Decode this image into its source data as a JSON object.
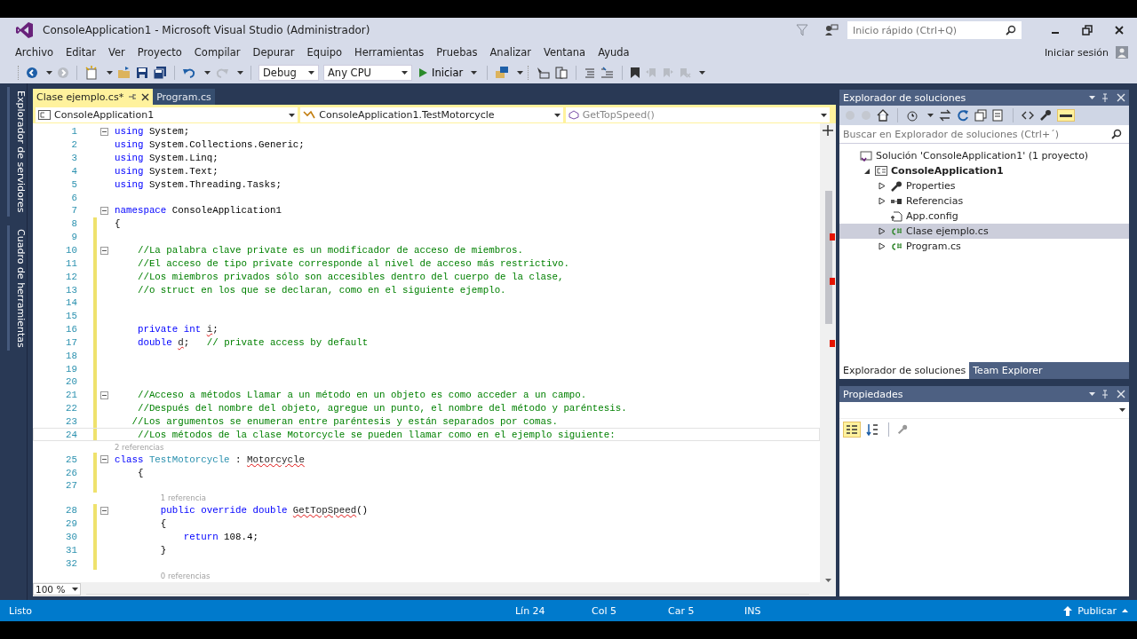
{
  "window": {
    "title": "ConsoleApplication1 - Microsoft Visual Studio (Administrador)",
    "quick_launch": {
      "placeholder": "Inicio rápido (Ctrl+Q)"
    },
    "sign_in": "Iniciar sesión"
  },
  "menu": [
    "Archivo",
    "Editar",
    "Ver",
    "Proyecto",
    "Compilar",
    "Depurar",
    "Equipo",
    "Herramientas",
    "Pruebas",
    "Analizar",
    "Ventana",
    "Ayuda"
  ],
  "toolbar": {
    "configuration": "Debug",
    "platform": "Any CPU",
    "start": "Iniciar"
  },
  "side_tabs": [
    "Explorador de servidores",
    "Cuadro de herramientas"
  ],
  "editor": {
    "tabs": [
      {
        "label": "Clase ejemplo.cs*",
        "selected": true
      },
      {
        "label": "Program.cs",
        "selected": false
      }
    ],
    "nav": [
      "ConsoleApplication1",
      "ConsoleApplication1.TestMotorcycle",
      "GetTopSpeed()"
    ],
    "zoom": "100 %",
    "lines": [
      {
        "kind": "code",
        "n": "1",
        "fold": true,
        "changed": false,
        "current": false,
        "tokens": [
          {
            "kind": "kw",
            "text": "using "
          },
          {
            "kind": "plain",
            "text": "System;"
          }
        ]
      },
      {
        "kind": "code",
        "n": "2",
        "fold": false,
        "changed": false,
        "current": false,
        "tokens": [
          {
            "kind": "kw",
            "text": "using "
          },
          {
            "kind": "plain",
            "text": "System.Collections.Generic;"
          }
        ]
      },
      {
        "kind": "code",
        "n": "3",
        "fold": false,
        "changed": false,
        "current": false,
        "tokens": [
          {
            "kind": "kw",
            "text": "using "
          },
          {
            "kind": "plain",
            "text": "System.Linq;"
          }
        ]
      },
      {
        "kind": "code",
        "n": "4",
        "fold": false,
        "changed": false,
        "current": false,
        "tokens": [
          {
            "kind": "kw",
            "text": "using "
          },
          {
            "kind": "plain",
            "text": "System.Text;"
          }
        ]
      },
      {
        "kind": "code",
        "n": "5",
        "fold": false,
        "changed": false,
        "current": false,
        "tokens": [
          {
            "kind": "kw",
            "text": "using "
          },
          {
            "kind": "plain",
            "text": "System.Threading.Tasks;"
          }
        ]
      },
      {
        "kind": "code",
        "n": "6",
        "fold": false,
        "changed": false,
        "current": false
      },
      {
        "kind": "code",
        "n": "7",
        "fold": true,
        "changed": false,
        "current": false,
        "tokens": [
          {
            "kind": "kw",
            "text": "namespace "
          },
          {
            "kind": "plain",
            "text": "ConsoleApplication1"
          }
        ]
      },
      {
        "kind": "code",
        "n": "8",
        "fold": false,
        "changed": true,
        "current": false,
        "tokens": [
          {
            "kind": "plain",
            "text": "{"
          }
        ]
      },
      {
        "kind": "code",
        "n": "9",
        "fold": false,
        "changed": true,
        "current": false
      },
      {
        "kind": "code",
        "n": "10",
        "fold": true,
        "changed": true,
        "current": false,
        "tokens": [
          {
            "kind": "com",
            "text": "    //La palabra clave private es un modificador de acceso de miembros."
          }
        ]
      },
      {
        "kind": "code",
        "n": "11",
        "fold": false,
        "changed": true,
        "current": false,
        "tokens": [
          {
            "kind": "com",
            "text": "    //El acceso de tipo private corresponde al nivel de acceso más restrictivo."
          }
        ]
      },
      {
        "kind": "code",
        "n": "12",
        "fold": false,
        "changed": true,
        "current": false,
        "tokens": [
          {
            "kind": "com",
            "text": "    //Los miembros privados sólo son accesibles dentro del cuerpo de la clase,"
          }
        ]
      },
      {
        "kind": "code",
        "n": "13",
        "fold": false,
        "changed": true,
        "current": false,
        "tokens": [
          {
            "kind": "com",
            "text": "    //o struct en los que se declaran, como en el siguiente ejemplo."
          }
        ]
      },
      {
        "kind": "code",
        "n": "14",
        "fold": false,
        "changed": true,
        "current": false
      },
      {
        "kind": "code",
        "n": "15",
        "fold": false,
        "changed": true,
        "current": false
      },
      {
        "kind": "code",
        "n": "16",
        "fold": false,
        "changed": true,
        "current": false,
        "tokens": [
          {
            "kind": "kw",
            "text": "    private int "
          },
          {
            "kind": "err",
            "text": "i"
          },
          {
            "kind": "plain",
            "text": ";"
          }
        ]
      },
      {
        "kind": "code",
        "n": "17",
        "fold": false,
        "changed": true,
        "current": false,
        "tokens": [
          {
            "kind": "kw",
            "text": "    double "
          },
          {
            "kind": "err",
            "text": "d"
          },
          {
            "kind": "plain",
            "text": ";"
          },
          {
            "kind": "com",
            "text": "   // private access by default"
          }
        ]
      },
      {
        "kind": "code",
        "n": "18",
        "fold": false,
        "changed": true,
        "current": false
      },
      {
        "kind": "code",
        "n": "19",
        "fold": false,
        "changed": true,
        "current": false
      },
      {
        "kind": "code",
        "n": "20",
        "fold": false,
        "changed": true,
        "current": false
      },
      {
        "kind": "code",
        "n": "21",
        "fold": true,
        "changed": true,
        "current": false,
        "tokens": [
          {
            "kind": "com",
            "text": "    //Acceso a métodos Llamar a un método en un objeto es como acceder a un campo."
          }
        ]
      },
      {
        "kind": "code",
        "n": "22",
        "fold": false,
        "changed": true,
        "current": false,
        "tokens": [
          {
            "kind": "com",
            "text": "    //Después del nombre del objeto, agregue un punto, el nombre del método y paréntesis."
          }
        ]
      },
      {
        "kind": "code",
        "n": "23",
        "fold": false,
        "changed": true,
        "current": false,
        "tokens": [
          {
            "kind": "com",
            "text": "   //Los argumentos se enumeran entre paréntesis y están separados por comas."
          }
        ]
      },
      {
        "kind": "code",
        "n": "24",
        "fold": false,
        "changed": true,
        "current": true,
        "tokens": [
          {
            "kind": "com",
            "text": "    //Los métodos de la clase Motorcycle se pueden llamar como en el ejemplo siguiente:"
          }
        ]
      },
      {
        "kind": "lens",
        "text": "2 referencias"
      },
      {
        "kind": "code",
        "n": "25",
        "fold": true,
        "changed": true,
        "current": false,
        "tokens": [
          {
            "kind": "kw",
            "text": "class "
          },
          {
            "kind": "type",
            "text": "TestMotorcycle"
          },
          {
            "kind": "plain",
            "text": " : "
          },
          {
            "kind": "err",
            "text": "Motorcycle"
          }
        ]
      },
      {
        "kind": "code",
        "n": "26",
        "fold": false,
        "changed": true,
        "current": false,
        "tokens": [
          {
            "kind": "plain",
            "text": "    {"
          }
        ]
      },
      {
        "kind": "code",
        "n": "27",
        "fold": false,
        "changed": true,
        "current": false
      },
      {
        "kind": "lens",
        "text": "1 referencia"
      },
      {
        "kind": "code",
        "n": "28",
        "fold": true,
        "changed": true,
        "current": false,
        "tokens": [
          {
            "kind": "kw",
            "text": "        public override double "
          },
          {
            "kind": "err",
            "text": "GetTopSpeed"
          },
          {
            "kind": "plain",
            "text": "()"
          }
        ]
      },
      {
        "kind": "code",
        "n": "29",
        "fold": false,
        "changed": true,
        "current": false,
        "tokens": [
          {
            "kind": "plain",
            "text": "        {"
          }
        ]
      },
      {
        "kind": "code",
        "n": "30",
        "fold": false,
        "changed": true,
        "current": false,
        "tokens": [
          {
            "kind": "kw",
            "text": "            return "
          },
          {
            "kind": "plain",
            "text": "108.4;"
          }
        ]
      },
      {
        "kind": "code",
        "n": "31",
        "fold": false,
        "changed": true,
        "current": false,
        "tokens": [
          {
            "kind": "plain",
            "text": "        }"
          }
        ]
      },
      {
        "kind": "code",
        "n": "32",
        "fold": false,
        "changed": true,
        "current": false
      },
      {
        "kind": "lens",
        "text": "0 referencias"
      }
    ]
  },
  "solution_explorer": {
    "title": "Explorador de soluciones",
    "search": {
      "placeholder": "Buscar en Explorador de soluciones (Ctrl+´)"
    },
    "tree": [
      {
        "kind": "solution",
        "label": "Solución 'ConsoleApplication1'  (1 proyecto)",
        "selected": false,
        "children": [
          {
            "kind": "project",
            "label": "ConsoleApplication1",
            "expanded": true,
            "selected": false,
            "children": [
              {
                "kind": "wrench",
                "label": "Properties",
                "expanded": false,
                "selected": false
              },
              {
                "kind": "references",
                "label": "Referencias",
                "expanded": false,
                "selected": false
              },
              {
                "kind": "config",
                "label": "App.config",
                "selected": false
              },
              {
                "kind": "csharp",
                "label": "Clase ejemplo.cs",
                "expanded": false,
                "selected": true
              },
              {
                "kind": "csharp",
                "label": "Program.cs",
                "expanded": false,
                "selected": false
              }
            ]
          }
        ]
      }
    ],
    "tabs": [
      {
        "label": "Explorador de soluciones",
        "selected": true
      },
      {
        "label": "Team Explorer",
        "selected": false
      }
    ]
  },
  "properties": {
    "title": "Propiedades"
  },
  "status_bar": {
    "message": "Listo",
    "line": "Lín 24",
    "col": "Col 5",
    "char": "Car 5",
    "mode": "INS",
    "publish": "Publicar"
  }
}
